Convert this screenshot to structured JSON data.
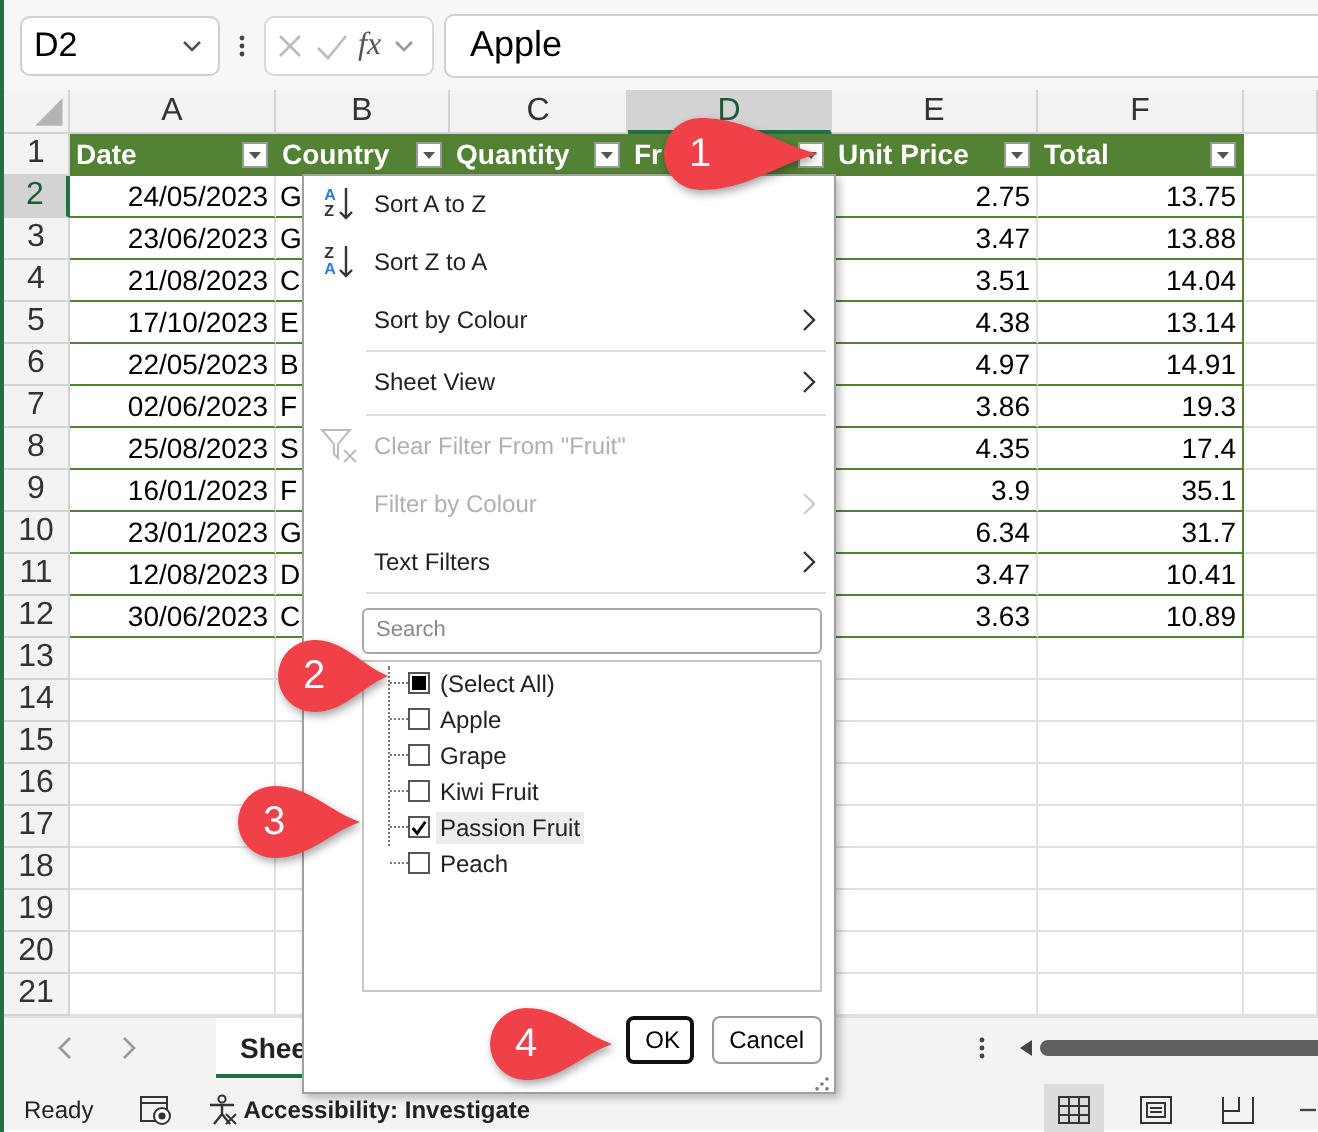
{
  "formula_bar": {
    "name_box": "D2",
    "function_label": "fx",
    "value": "Apple"
  },
  "columns": [
    {
      "label": "A",
      "selected": false
    },
    {
      "label": "B",
      "selected": false
    },
    {
      "label": "C",
      "selected": false
    },
    {
      "label": "D",
      "selected": true
    },
    {
      "label": "E",
      "selected": false
    },
    {
      "label": "F",
      "selected": false
    }
  ],
  "row_numbers": [
    {
      "label": "1",
      "selected": false
    },
    {
      "label": "2",
      "selected": true
    },
    {
      "label": "3",
      "selected": false
    },
    {
      "label": "4",
      "selected": false
    },
    {
      "label": "5",
      "selected": false
    },
    {
      "label": "6",
      "selected": false
    },
    {
      "label": "7",
      "selected": false
    },
    {
      "label": "8",
      "selected": false
    },
    {
      "label": "9",
      "selected": false
    },
    {
      "label": "10",
      "selected": false
    },
    {
      "label": "11",
      "selected": false
    },
    {
      "label": "12",
      "selected": false
    },
    {
      "label": "13",
      "selected": false
    },
    {
      "label": "14",
      "selected": false
    },
    {
      "label": "15",
      "selected": false
    },
    {
      "label": "16",
      "selected": false
    },
    {
      "label": "17",
      "selected": false
    },
    {
      "label": "18",
      "selected": false
    },
    {
      "label": "19",
      "selected": false
    },
    {
      "label": "20",
      "selected": false
    },
    {
      "label": "21",
      "selected": false
    }
  ],
  "table": {
    "headers": [
      "Date",
      "Country",
      "Quantity",
      "Fr",
      "Unit Price",
      "Total"
    ],
    "rows": [
      {
        "date": "24/05/2023",
        "country": "G",
        "unit_price": "2.75",
        "total": "13.75"
      },
      {
        "date": "23/06/2023",
        "country": "G",
        "unit_price": "3.47",
        "total": "13.88"
      },
      {
        "date": "21/08/2023",
        "country": "C",
        "unit_price": "3.51",
        "total": "14.04"
      },
      {
        "date": "17/10/2023",
        "country": "E",
        "unit_price": "4.38",
        "total": "13.14"
      },
      {
        "date": "22/05/2023",
        "country": "B",
        "unit_price": "4.97",
        "total": "14.91"
      },
      {
        "date": "02/06/2023",
        "country": "F",
        "unit_price": "3.86",
        "total": "19.3"
      },
      {
        "date": "25/08/2023",
        "country": "S",
        "unit_price": "4.35",
        "total": "17.4"
      },
      {
        "date": "16/01/2023",
        "country": "F",
        "unit_price": "3.9",
        "total": "35.1"
      },
      {
        "date": "23/01/2023",
        "country": "G",
        "unit_price": "6.34",
        "total": "31.7"
      },
      {
        "date": "12/08/2023",
        "country": "D",
        "unit_price": "3.47",
        "total": "10.41"
      },
      {
        "date": "30/06/2023",
        "country": "C",
        "unit_price": "3.63",
        "total": "10.89"
      }
    ]
  },
  "filter_menu": {
    "items": [
      {
        "kind": "sort-asc",
        "icon_letters": [
          "A",
          "Z"
        ],
        "label": "Sort A to Z",
        "submenu": false,
        "disabled": false
      },
      {
        "kind": "sort-desc",
        "icon_letters": [
          "Z",
          "A"
        ],
        "label": "Sort Z to A",
        "submenu": false,
        "disabled": false
      },
      {
        "kind": "item",
        "label": "Sort by Colour",
        "submenu": true,
        "disabled": false
      },
      {
        "kind": "separator"
      },
      {
        "kind": "item",
        "label": "Sheet View",
        "submenu": true,
        "disabled": false
      },
      {
        "kind": "separator"
      },
      {
        "kind": "clear-filter",
        "label": "Clear Filter From \"Fruit\"",
        "submenu": false,
        "disabled": true
      },
      {
        "kind": "item",
        "label": "Filter by Colour",
        "submenu": true,
        "disabled": true
      },
      {
        "kind": "item",
        "label": "Text Filters",
        "submenu": true,
        "disabled": false
      },
      {
        "kind": "separator"
      }
    ],
    "search": {
      "placeholder": "Search"
    },
    "values": [
      {
        "label": "(Select All)",
        "checked": false,
        "mixed": true,
        "highlighted": false
      },
      {
        "label": "Apple",
        "checked": false,
        "mixed": false,
        "highlighted": false
      },
      {
        "label": "Grape",
        "checked": false,
        "mixed": false,
        "highlighted": false
      },
      {
        "label": "Kiwi Fruit",
        "checked": false,
        "mixed": false,
        "highlighted": false
      },
      {
        "label": "Passion Fruit",
        "checked": true,
        "mixed": false,
        "highlighted": true
      },
      {
        "label": "Peach",
        "checked": false,
        "mixed": false,
        "highlighted": false
      }
    ],
    "buttons": [
      {
        "label": "OK",
        "default": true
      },
      {
        "label": "Cancel",
        "default": false
      }
    ]
  },
  "sheet_tabs": [
    {
      "label": "Shee",
      "selected": true
    }
  ],
  "status_bar": {
    "mode": "Ready",
    "accessibility": "Accessibility: Investigate",
    "views": [
      {
        "kind": "normal",
        "selected": true
      },
      {
        "kind": "page-layout",
        "selected": false
      },
      {
        "kind": "page-break",
        "selected": false
      }
    ]
  },
  "callouts": [
    {
      "label": "1"
    },
    {
      "label": "2"
    },
    {
      "label": "3"
    },
    {
      "label": "4"
    }
  ]
}
